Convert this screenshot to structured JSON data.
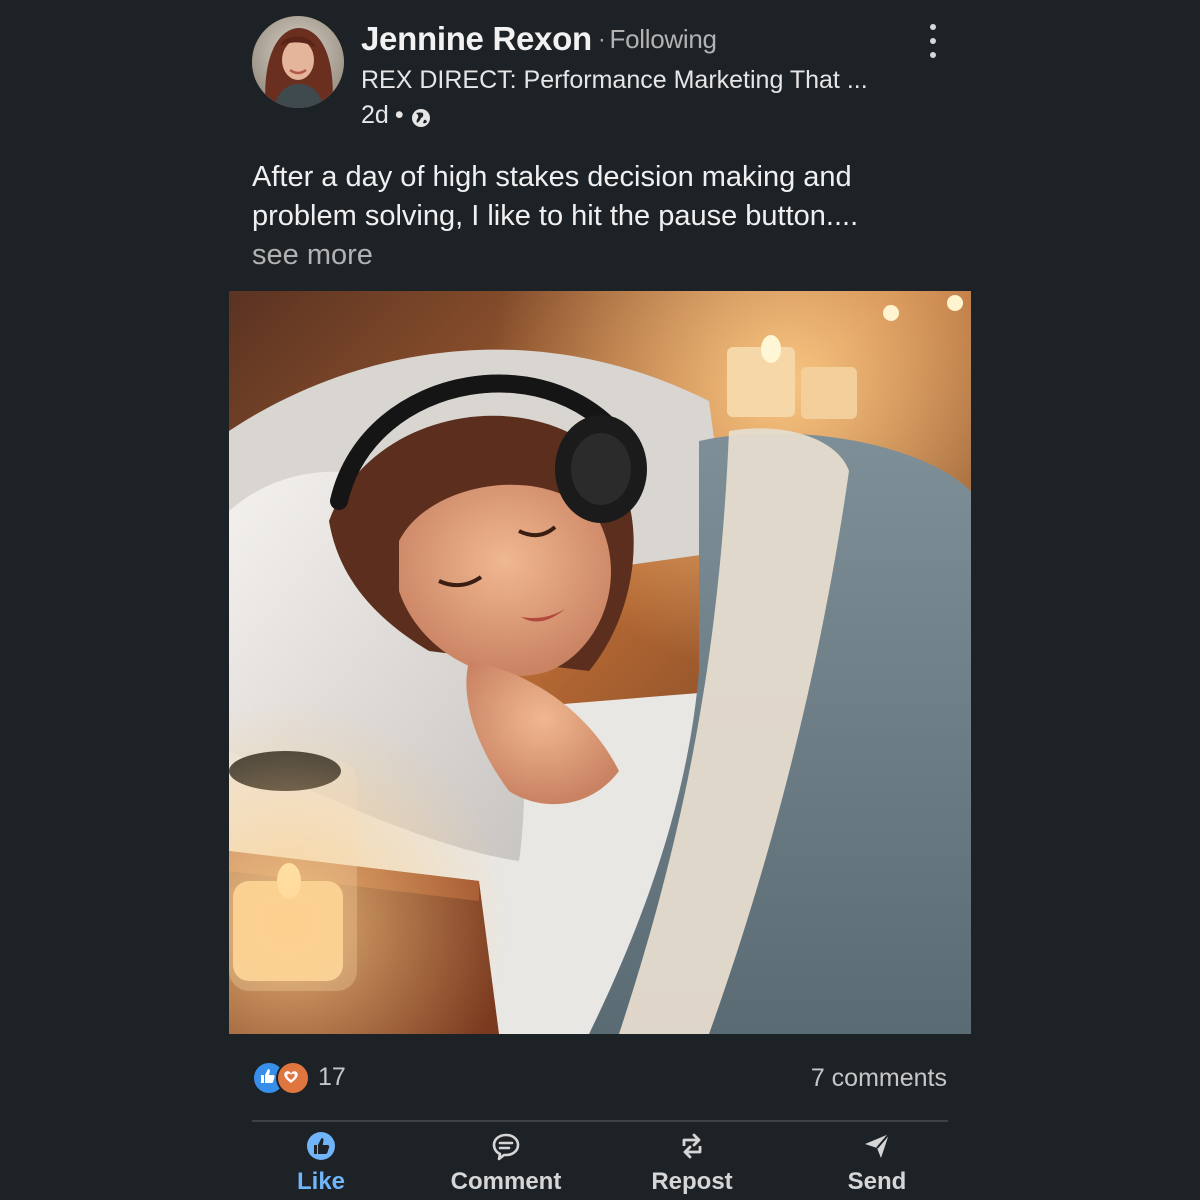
{
  "author": {
    "name": "Jennine Rexon",
    "separator": "·",
    "follow_status": "Following",
    "headline": "REX DIRECT: Performance Marketing That ...",
    "time": "2d",
    "time_separator": "•",
    "visibility_icon": "globe-icon"
  },
  "post": {
    "text": "After a day of high stakes decision making and problem solving, I like to hit the pause button....",
    "see_more": " see more"
  },
  "social": {
    "reaction_icons": [
      "like-reaction-icon",
      "love-reaction-icon"
    ],
    "reaction_count": "17",
    "comments": "7 comments"
  },
  "actions": [
    {
      "label": "Like",
      "icon": "like-icon"
    },
    {
      "label": "Comment",
      "icon": "comment-icon"
    },
    {
      "label": "Repost",
      "icon": "repost-icon"
    },
    {
      "label": "Send",
      "icon": "send-icon"
    }
  ],
  "colors": {
    "background": "#1d2226",
    "accent": "#70b5f9",
    "love": "#e0763f",
    "text_secondary": "#b2b2b2"
  }
}
